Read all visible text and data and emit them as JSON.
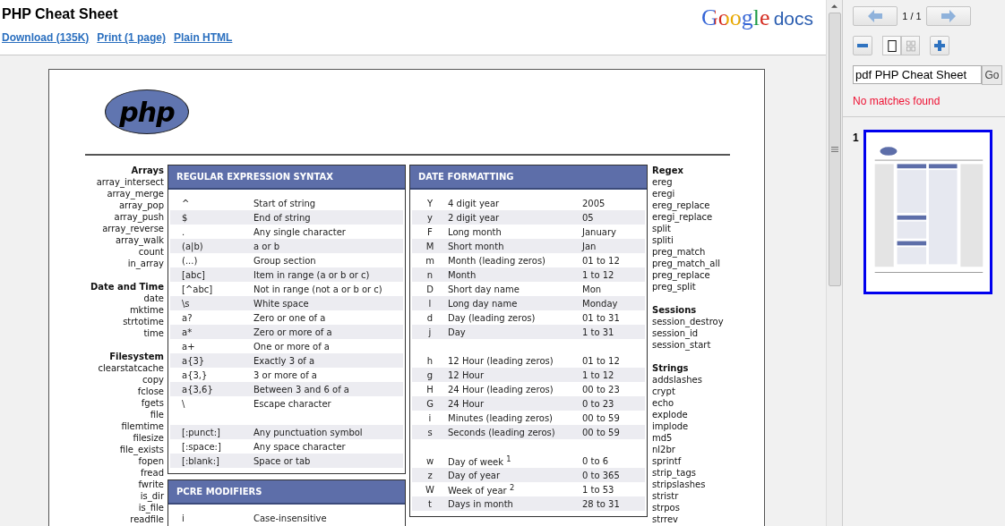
{
  "header": {
    "title": "PHP Cheat Sheet",
    "links": [
      "Download (135K)",
      "Print (1 page)",
      "Plain HTML"
    ],
    "logo": {
      "brand": "Google",
      "product": "docs"
    }
  },
  "document": {
    "logo_text": "php",
    "left_groups": [
      {
        "heading": "Arrays",
        "items": [
          "array_intersect",
          "array_merge",
          "array_pop",
          "array_push",
          "array_reverse",
          "array_walk",
          "count",
          "in_array"
        ]
      },
      {
        "heading": "Date and Time",
        "items": [
          "date",
          "mktime",
          "strtotime",
          "time"
        ]
      },
      {
        "heading": "Filesystem",
        "items": [
          "clearstatcache",
          "copy",
          "fclose",
          "fgets",
          "file",
          "filemtime",
          "filesize",
          "file_exists",
          "fopen",
          "fread",
          "fwrite",
          "is_dir",
          "is_file",
          "readfile"
        ]
      }
    ],
    "table_columns": [
      [
        {
          "title": "REGULAR EXPRESSION SYNTAX",
          "groups": [
            [
              {
                "cells": [
                  "^",
                  "Start of string"
                ],
                "shaded": false
              },
              {
                "cells": [
                  "$",
                  "End of string"
                ],
                "shaded": true
              },
              {
                "cells": [
                  ".",
                  "Any single character"
                ],
                "shaded": false
              },
              {
                "cells": [
                  "(a|b)",
                  "a or b"
                ],
                "shaded": true
              },
              {
                "cells": [
                  "(...)",
                  "Group section"
                ],
                "shaded": false
              },
              {
                "cells": [
                  "[abc]",
                  "Item in range (a or b or c)"
                ],
                "shaded": true
              },
              {
                "cells": [
                  "[^abc]",
                  "Not in range (not a or b or c)"
                ],
                "shaded": false
              },
              {
                "cells": [
                  "\\s",
                  "White space"
                ],
                "shaded": true
              },
              {
                "cells": [
                  "a?",
                  "Zero or one of a"
                ],
                "shaded": false
              },
              {
                "cells": [
                  "a*",
                  "Zero or more of a"
                ],
                "shaded": true
              },
              {
                "cells": [
                  "a+",
                  "One or more of a"
                ],
                "shaded": false
              },
              {
                "cells": [
                  "a{3}",
                  "Exactly 3 of a"
                ],
                "shaded": true
              },
              {
                "cells": [
                  "a{3,}",
                  "3 or more of a"
                ],
                "shaded": false
              },
              {
                "cells": [
                  "a{3,6}",
                  "Between 3 and 6 of a"
                ],
                "shaded": true
              },
              {
                "cells": [
                  "\\",
                  "Escape character"
                ],
                "shaded": false
              }
            ],
            [
              {
                "cells": [
                  "[:punct:]",
                  "Any punctuation symbol"
                ],
                "shaded": true
              },
              {
                "cells": [
                  "[:space:]",
                  "Any space character"
                ],
                "shaded": false
              },
              {
                "cells": [
                  "[:blank:]",
                  "Space or tab"
                ],
                "shaded": true
              }
            ]
          ]
        },
        {
          "title": "PCRE MODIFIERS",
          "groups": [
            [
              {
                "cells": [
                  "i",
                  "Case-insensitive"
                ],
                "shaded": false
              }
            ]
          ]
        }
      ],
      [
        {
          "title": "DATE FORMATTING",
          "groups": [
            [
              {
                "cells": [
                  "Y",
                  "4 digit year",
                  "2005"
                ],
                "shaded": false
              },
              {
                "cells": [
                  "y",
                  "2 digit year",
                  "05"
                ],
                "shaded": true
              },
              {
                "cells": [
                  "F",
                  "Long month",
                  "January"
                ],
                "shaded": false
              },
              {
                "cells": [
                  "M",
                  "Short month",
                  "Jan"
                ],
                "shaded": true
              },
              {
                "cells": [
                  "m",
                  "Month (leading zeros)",
                  "01 to 12"
                ],
                "shaded": false
              },
              {
                "cells": [
                  "n",
                  "Month",
                  "1 to 12"
                ],
                "shaded": true
              },
              {
                "cells": [
                  "D",
                  "Short day name",
                  "Mon"
                ],
                "shaded": false
              },
              {
                "cells": [
                  "l",
                  "Long day name",
                  "Monday"
                ],
                "shaded": true
              },
              {
                "cells": [
                  "d",
                  "Day (leading zeros)",
                  "01 to 31"
                ],
                "shaded": false
              },
              {
                "cells": [
                  "j",
                  "Day",
                  "1 to 31"
                ],
                "shaded": true
              }
            ],
            [
              {
                "cells": [
                  "h",
                  "12 Hour (leading zeros)",
                  "01 to 12"
                ],
                "shaded": false
              },
              {
                "cells": [
                  "g",
                  "12 Hour",
                  "1 to 12"
                ],
                "shaded": true
              },
              {
                "cells": [
                  "H",
                  "24 Hour (leading zeros)",
                  "00 to 23"
                ],
                "shaded": false
              },
              {
                "cells": [
                  "G",
                  "24 Hour",
                  "0 to 23"
                ],
                "shaded": true
              },
              {
                "cells": [
                  "i",
                  "Minutes (leading zeros)",
                  "00 to 59"
                ],
                "shaded": false
              },
              {
                "cells": [
                  "s",
                  "Seconds (leading zeros)",
                  "00 to 59"
                ],
                "shaded": true
              }
            ],
            [
              {
                "cells": [
                  "w",
                  "Day of week $^{1}$",
                  "0 to 6"
                ],
                "shaded": false
              },
              {
                "cells": [
                  "z",
                  "Day of year",
                  "0 to 365"
                ],
                "shaded": true
              },
              {
                "cells": [
                  "W",
                  "Week of year $^{2}$",
                  "1 to 53"
                ],
                "shaded": false
              },
              {
                "cells": [
                  "t",
                  "Days in month",
                  "28 to 31"
                ],
                "shaded": true
              }
            ]
          ]
        }
      ]
    ],
    "right_groups": [
      {
        "heading": "Regex",
        "items": [
          "ereg",
          "eregi",
          "ereg_replace",
          "eregi_replace",
          "split",
          "spliti",
          "preg_match",
          "preg_match_all",
          "preg_replace",
          "preg_split"
        ]
      },
      {
        "heading": "Sessions",
        "items": [
          "session_destroy",
          "session_id",
          "session_start"
        ]
      },
      {
        "heading": "Strings",
        "items": [
          "addslashes",
          "crypt",
          "echo",
          "explode",
          "implode",
          "md5",
          "nl2br",
          "sprintf",
          "strip_tags",
          "stripslashes",
          "stristr",
          "strpos",
          "strrev"
        ]
      }
    ]
  },
  "panel": {
    "page_count": "1 / 1",
    "view_modes": [
      {
        "kind": "single",
        "selected": true
      },
      {
        "kind": "grid",
        "selected": false
      }
    ],
    "search": {
      "value": "pdf PHP Cheat Sheet",
      "button": "Go"
    },
    "message": "No matches found",
    "thumbnails": [
      {
        "number": "1",
        "selected": true
      }
    ]
  }
}
